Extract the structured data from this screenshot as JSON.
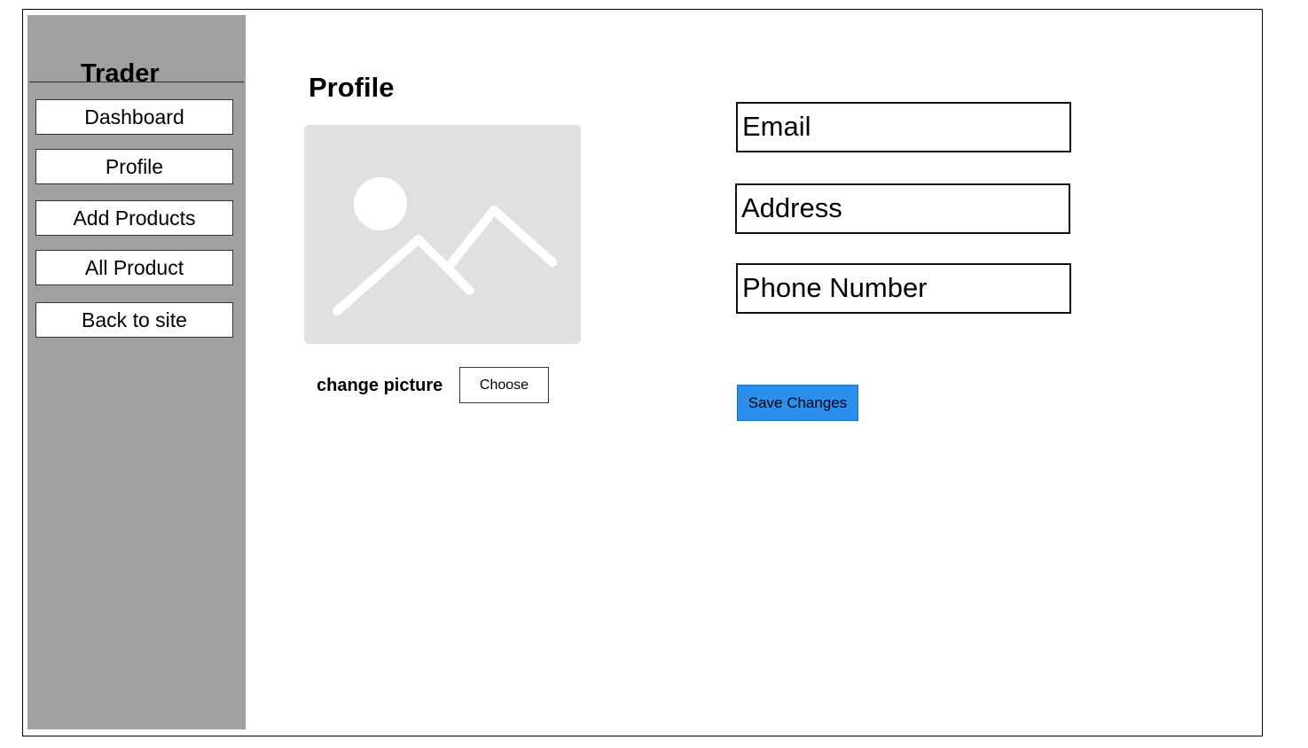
{
  "sidebar": {
    "brand": "Trader",
    "items": [
      {
        "label": "Dashboard"
      },
      {
        "label": "Profile"
      },
      {
        "label": "Add Products"
      },
      {
        "label": "All Product"
      },
      {
        "label": "Back to site"
      }
    ]
  },
  "main": {
    "title": "Profile",
    "avatar_icon": "image-placeholder-icon",
    "change_picture_label": "change picture",
    "choose_label": "Choose",
    "fields": {
      "email_placeholder": "Email",
      "address_placeholder": "Address",
      "phone_placeholder": "Phone Number"
    },
    "save_label": "Save Changes",
    "colors": {
      "sidebar_bg": "#a0a0a0",
      "avatar_bg": "#e0e0e0",
      "save_button": "#2b8ff0"
    }
  }
}
